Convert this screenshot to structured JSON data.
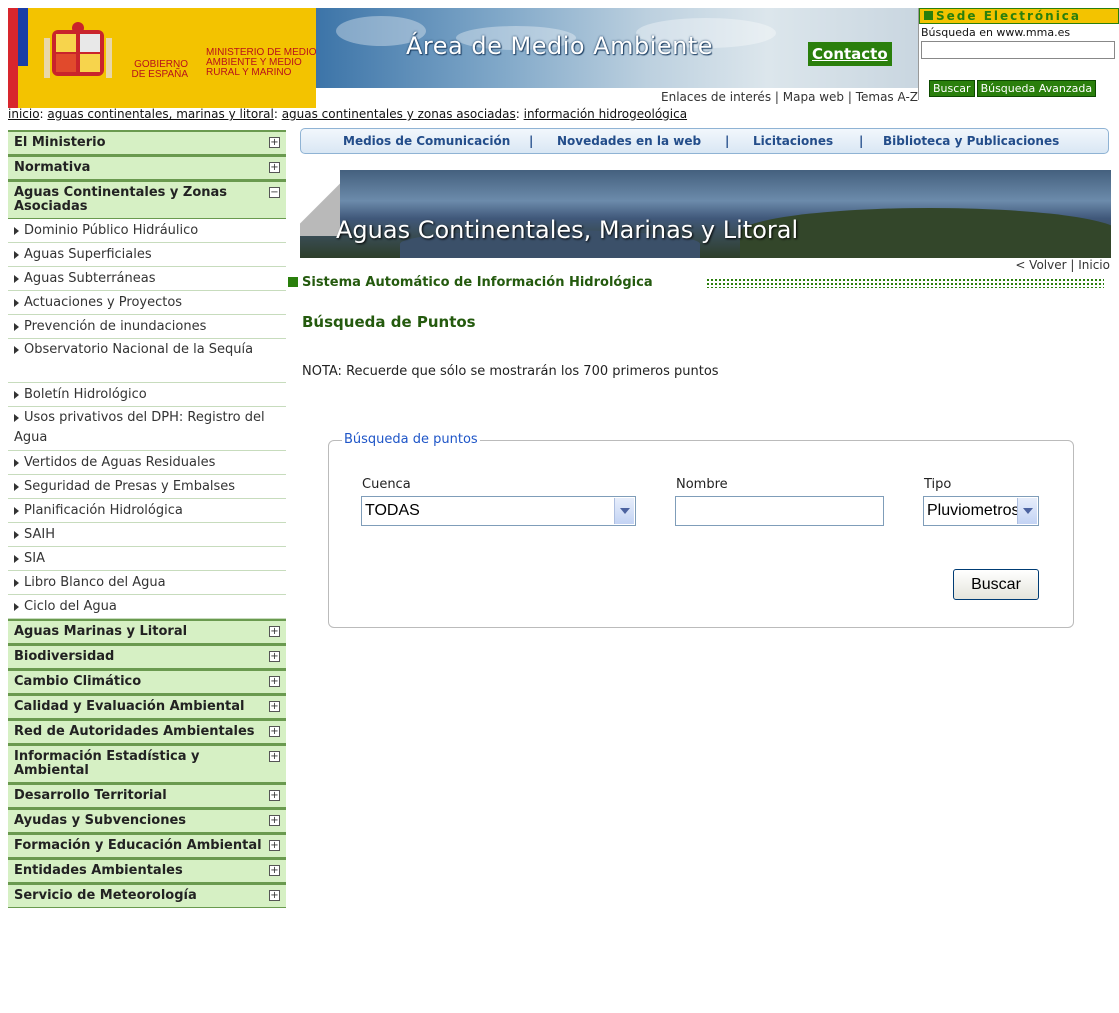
{
  "header": {
    "gov_name": "GOBIERNO DE ESPAÑA",
    "ministry": "MINISTERIO DE MEDIO AMBIENTE Y MEDIO RURAL Y MARINO",
    "title": "Área de Medio Ambiente",
    "contact": "Contacto",
    "links": "Enlaces de interés | Mapa web | Temas A-Z"
  },
  "sede": {
    "title": "Sede Electrónica",
    "search_label": "Búsqueda en www.mma.es",
    "search_value": "",
    "search_button": "Buscar",
    "advanced_button": "Búsqueda Avanzada"
  },
  "breadcrumb": {
    "items": [
      "inicio",
      "aguas continentales, marinas y litoral",
      "aguas continentales y zonas asociadas",
      "información hidrogeológica"
    ]
  },
  "sidebar": {
    "top_sections": [
      "El Ministerio",
      "Normativa"
    ],
    "open_section": "Aguas Continentales y Zonas Asociadas",
    "open_items": [
      "Dominio Público Hidráulico",
      "Aguas Superficiales",
      "Aguas Subterráneas",
      "Actuaciones y Proyectos",
      "Prevención de inundaciones",
      "Observatorio Nacional de la Sequía",
      "Boletín Hidrológico",
      "Usos privativos del DPH: Registro del Agua",
      "Vertidos de Aguas Residuales",
      "Seguridad de Presas y Embalses",
      "Planificación Hidrológica",
      "SAIH",
      "SIA",
      "Libro Blanco del Agua",
      "Ciclo del Agua"
    ],
    "bottom_sections": [
      "Aguas Marinas y Litoral",
      "Biodiversidad",
      "Cambio Climático",
      "Calidad y Evaluación Ambiental",
      "Red de Autoridades Ambientales",
      "Información Estadística y Ambiental",
      "Desarrollo Territorial",
      "Ayudas y Subvenciones",
      "Formación y Educación Ambiental",
      "Entidades Ambientales",
      "Servicio de Meteorología"
    ],
    "plus": "+",
    "minus": "−"
  },
  "topnav": {
    "items": [
      "Medios de Comunicación",
      "Novedades en la web",
      "Licitaciones",
      "Biblioteca y Publicaciones"
    ],
    "separator": "|"
  },
  "banner": {
    "title": "Aguas Continentales, Marinas y Litoral",
    "back": "< Volver",
    "home": "Inicio"
  },
  "main": {
    "section_title": "Sistema Automático de Información Hidrológica",
    "page_title": "Búsqueda de Puntos",
    "note": "NOTA: Recuerde que sólo se mostrarán los 700 primeros puntos",
    "form": {
      "legend": "Búsqueda de puntos",
      "cuenca_label": "Cuenca",
      "cuenca_value": "TODAS",
      "nombre_label": "Nombre",
      "nombre_value": "",
      "tipo_label": "Tipo",
      "tipo_value": "Pluviometros",
      "submit": "Buscar"
    }
  },
  "colors": {
    "accent_green": "#2a7f0c",
    "sidebar_bg": "#d6f0c4",
    "gov_yellow": "#f3c300",
    "link_blue": "#234d8a"
  }
}
